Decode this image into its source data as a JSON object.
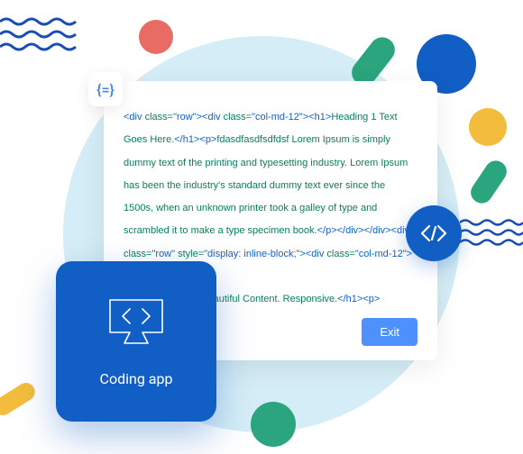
{
  "decorations": {
    "colors": {
      "blue": "#115ec4",
      "lightblue": "#4d90fe",
      "green": "#2ba57e",
      "yellow": "#f3bc3c",
      "coral": "#e86c63",
      "pale": "#d5edf6"
    }
  },
  "braceBadge": "{=}",
  "codeCard": {
    "html": "<div class=\"row\"><div class=\"col-md-12\"><h1>Heading 1 Text Goes Here.</h1><p>fdasdfasdfsdfdsf Lorem Ipsum is simply dummy text of the printing and typesetting industry. Lorem Ipsum has been the industry's standard dummy text ever since the 1500s, when an unknown printer took a galley of type and scrambled it to make a type specimen book.</p></div></div><div class=\"row\" style=\"display: inline-block;\"><div class=\"col-md-12\"><div ...eautiful Content. Responsive.</h1><p><i>Lorem ... y text of the printing and typesetting industry.</i></...",
    "exit": "Exit"
  },
  "appTile": {
    "label": "Coding app"
  }
}
